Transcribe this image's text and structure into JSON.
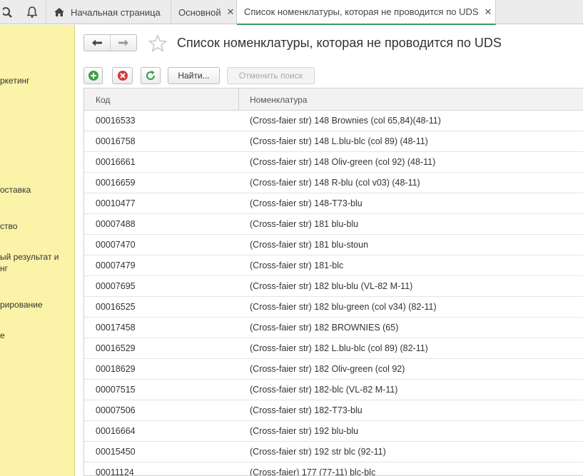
{
  "tabs": [
    {
      "label": "Начальная страница",
      "closable": false
    },
    {
      "label": "Основной",
      "closable": true
    },
    {
      "label": "Список номенклатуры, которая не проводится по UDS",
      "closable": true
    }
  ],
  "sidebar": {
    "items": [
      {
        "label": "ркетинг"
      },
      {
        "label": "оставка"
      },
      {
        "label": "ство"
      },
      {
        "label": "ый результат и"
      },
      {
        "label": "нг"
      },
      {
        "label": "рирование"
      },
      {
        "label": "е"
      }
    ]
  },
  "page": {
    "title": "Список номенклатуры, которая не проводится по UDS"
  },
  "toolbar": {
    "find_label": "Найти...",
    "cancel_search_label": "Отменить поиск"
  },
  "table": {
    "columns": [
      "Код",
      "Номенклатура"
    ],
    "rows": [
      {
        "code": "00016533",
        "name": "(Cross-faier str) 148 Brownies (col 65,84)(48-11)"
      },
      {
        "code": "00016758",
        "name": "(Cross-faier str) 148 L.blu-blc (col 89) (48-11)"
      },
      {
        "code": "00016661",
        "name": "(Cross-faier str) 148 Oliv-green (col 92) (48-11)"
      },
      {
        "code": "00016659",
        "name": "(Cross-faier str) 148 R-blu (col v03) (48-11)"
      },
      {
        "code": "00010477",
        "name": "(Cross-faier str) 148-T73-blu"
      },
      {
        "code": "00007488",
        "name": "(Cross-faier str) 181 blu-blu"
      },
      {
        "code": "00007470",
        "name": "(Cross-faier str) 181 blu-stoun"
      },
      {
        "code": "00007479",
        "name": "(Cross-faier str) 181-blc"
      },
      {
        "code": "00007695",
        "name": "(Cross-faier str) 182 blu-blu (VL-82 M-11)"
      },
      {
        "code": "00016525",
        "name": "(Cross-faier str) 182 blu-green (col v34) (82-11)"
      },
      {
        "code": "00017458",
        "name": "(Cross-faier str) 182 BROWNIES (65)"
      },
      {
        "code": "00016529",
        "name": "(Cross-faier str) 182 L.blu-blc (col 89) (82-11)"
      },
      {
        "code": "00018629",
        "name": "(Cross-faier str) 182 Oliv-green (col 92)"
      },
      {
        "code": "00007515",
        "name": "(Cross-faier str) 182-blc (VL-82 M-11)"
      },
      {
        "code": "00007506",
        "name": "(Cross-faier str) 182-T73-blu"
      },
      {
        "code": "00016664",
        "name": "(Cross-faier str) 192 blu-blu"
      },
      {
        "code": "00015450",
        "name": "(Cross-faier str) 192 str blc (92-11)"
      },
      {
        "code": "00011124",
        "name": "(Cross-faier) 177 (77-11) blc-blc"
      }
    ]
  },
  "colors": {
    "sidebar_bg": "#fbf3a8",
    "active_tab_underline": "#3a9c5d",
    "add_green": "#3aa043",
    "delete_red": "#d23a3a",
    "refresh_green": "#2e9b46"
  },
  "icons": [
    "search-icon",
    "bell-icon",
    "home-icon",
    "back-arrow-icon",
    "forward-arrow-icon",
    "star-icon",
    "add-icon",
    "delete-icon",
    "refresh-icon",
    "close-icon"
  ]
}
